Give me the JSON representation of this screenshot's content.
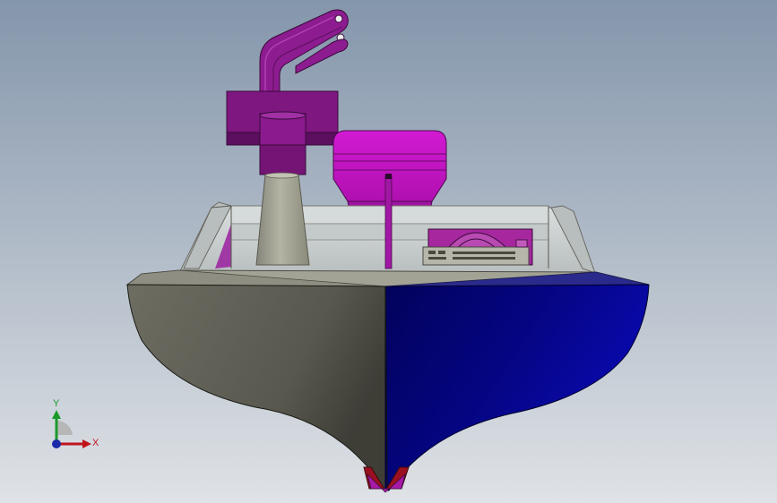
{
  "viewport": {
    "background_top": "#8496ab",
    "background_bottom": "#dfe2e6"
  },
  "model": {
    "hull_port_color": "#5b5b52",
    "hull_starboard_color": "#05057f",
    "deck_color": "#a7a79a",
    "windshield_color": "#c9cfcf",
    "mast_color": "#9a9a86",
    "purple_parts_color": "#8b1a8e",
    "magenta_housing_color": "#cc10cc"
  },
  "triad": {
    "x_label": "X",
    "y_label": "Y",
    "x_color": "#c0141c",
    "y_color": "#1a9a2a",
    "z_color": "#1a2aa8"
  }
}
